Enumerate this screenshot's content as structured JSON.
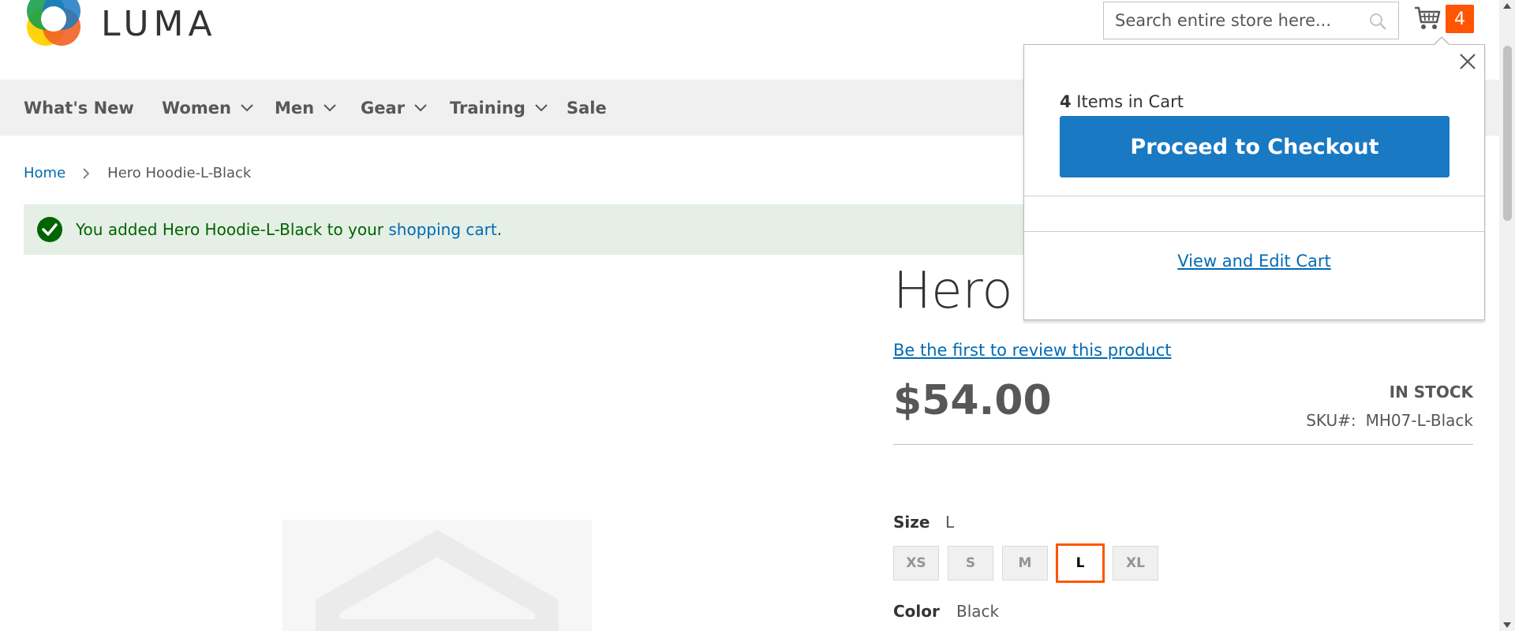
{
  "header": {
    "logo_text": "LUMA",
    "search_placeholder": "Search entire store here...",
    "cart_count": "4"
  },
  "nav": {
    "items": [
      {
        "label": "What's New",
        "dropdown": false
      },
      {
        "label": "Women",
        "dropdown": true
      },
      {
        "label": "Men",
        "dropdown": true
      },
      {
        "label": "Gear",
        "dropdown": true
      },
      {
        "label": "Training",
        "dropdown": true
      },
      {
        "label": "Sale",
        "dropdown": false
      }
    ]
  },
  "breadcrumb": {
    "home": "Home",
    "current": "Hero Hoodie-L-Black"
  },
  "message": {
    "prefix": "You added Hero Hoodie-L-Black to your ",
    "link": "shopping cart",
    "suffix": "."
  },
  "product": {
    "title": "Hero Hoodie-L-Black",
    "review_link": "Be the first to review this product",
    "price": "$54.00",
    "stock": "IN STOCK",
    "sku_label": "SKU#:",
    "sku_value": "MH07-L-Black",
    "size_label": "Size",
    "size_value": "L",
    "sizes": [
      "XS",
      "S",
      "M",
      "L",
      "XL"
    ],
    "selected_size": "L",
    "color_label": "Color",
    "color_value": "Black"
  },
  "minicart": {
    "count": "4",
    "count_suffix": " Items in Cart",
    "checkout_label": "Proceed to Checkout",
    "view_cart_label": "View and Edit Cart"
  },
  "colors": {
    "accent": "#1979c3",
    "badge": "#ff5501",
    "link": "#006bb4",
    "success_bg": "#e5efe5",
    "success_text": "#006400"
  }
}
